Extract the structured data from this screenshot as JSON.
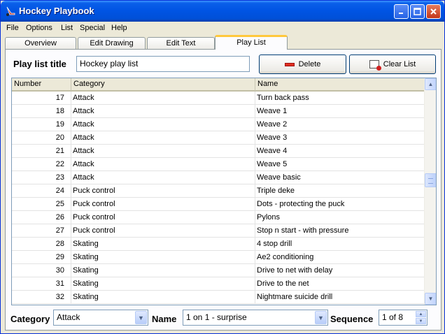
{
  "window": {
    "title": "Hockey Playbook"
  },
  "menu": {
    "items": [
      "File",
      "Options",
      "List",
      "Special",
      "Help"
    ]
  },
  "tabs": [
    {
      "label": "Overview"
    },
    {
      "label": "Edit Drawing"
    },
    {
      "label": "Edit Text"
    },
    {
      "label": "Play List"
    }
  ],
  "playlist": {
    "title_label": "Play list title",
    "title_value": "Hockey play list",
    "delete_label": "Delete",
    "clear_label": "Clear List"
  },
  "grid": {
    "columns": [
      "Number",
      "Category",
      "Name"
    ],
    "rows": [
      {
        "number": "17",
        "category": "Attack",
        "name": "Turn back pass"
      },
      {
        "number": "18",
        "category": "Attack",
        "name": "Weave 1"
      },
      {
        "number": "19",
        "category": "Attack",
        "name": "Weave 2"
      },
      {
        "number": "20",
        "category": "Attack",
        "name": "Weave 3"
      },
      {
        "number": "21",
        "category": "Attack",
        "name": "Weave 4"
      },
      {
        "number": "22",
        "category": "Attack",
        "name": "Weave 5"
      },
      {
        "number": "23",
        "category": "Attack",
        "name": "Weave basic"
      },
      {
        "number": "24",
        "category": "Puck control",
        "name": "Triple deke"
      },
      {
        "number": "25",
        "category": "Puck control",
        "name": "Dots - protecting the puck"
      },
      {
        "number": "26",
        "category": "Puck control",
        "name": "Pylons"
      },
      {
        "number": "27",
        "category": "Puck control",
        "name": "Stop n start - with pressure"
      },
      {
        "number": "28",
        "category": "Skating",
        "name": "4 stop drill"
      },
      {
        "number": "29",
        "category": "Skating",
        "name": "Ae2 conditioning"
      },
      {
        "number": "30",
        "category": "Skating",
        "name": "Drive to net with delay"
      },
      {
        "number": "31",
        "category": "Skating",
        "name": "Drive to the net"
      },
      {
        "number": "32",
        "category": "Skating",
        "name": "Nightmare suicide drill"
      }
    ]
  },
  "filters": {
    "category_label": "Category",
    "category_value": "Attack",
    "name_label": "Name",
    "name_value": "1 on 1 - surprise",
    "sequence_label": "Sequence",
    "sequence_value": "1 of 8"
  },
  "colors": {
    "titlebar": "#0054e3",
    "active_tab_accent": "#ffc83c",
    "window_bg": "#ece9d8"
  }
}
